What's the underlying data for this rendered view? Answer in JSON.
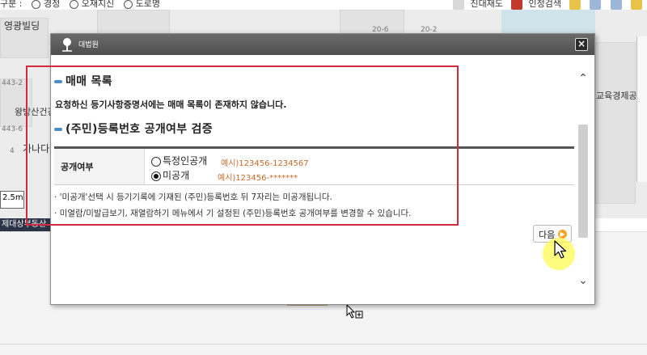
{
  "background": {
    "topbar": {
      "prefix": "구분 :",
      "options": [
        "경정",
        "오재지신",
        "도로명"
      ],
      "tools": [
        "진대재도",
        "인정검색"
      ]
    },
    "map": {
      "labels": [
        "영광빌딩",
        "왕방산건강원",
        "가나다",
        "교육경제공"
      ],
      "small_labels": [
        "443-2",
        "20-6",
        "20-2",
        "443-6",
        "4"
      ],
      "scale": "2.5m"
    },
    "darkbar_text": "제대상부동산"
  },
  "dialog": {
    "logo_text": "대법원",
    "close_label": "×",
    "section1_title": "매매 목록",
    "section1_message": "요청하신 등기사항증명서에는 매매 목록이 존재하지 않습니다.",
    "section2_title": "(주민)등록번호 공개여부 검증",
    "table": {
      "header": "공개여부",
      "options": [
        {
          "label": "특정인공개",
          "example": "예시)123456-1234567",
          "selected": false
        },
        {
          "label": "미공개",
          "example": "예시)123456-*******",
          "selected": true
        }
      ]
    },
    "notes": [
      "· '미공개'선택 시 등기기록에 기재된 (주민)등록번호 뒤 7자리는 미공개됩니다.",
      "· 미열람/미발급보기, 재열람하기 메뉴에서 기 설정된 (주민)등록번호 공개여부를 변경할 수 있습니다."
    ],
    "next_label": "다음"
  },
  "colors": {
    "highlight_box": "#d42a3d",
    "accent_bullet": "#4d8cc9",
    "example_text": "#c86a2a",
    "cursor_highlight": "#fffa50"
  }
}
